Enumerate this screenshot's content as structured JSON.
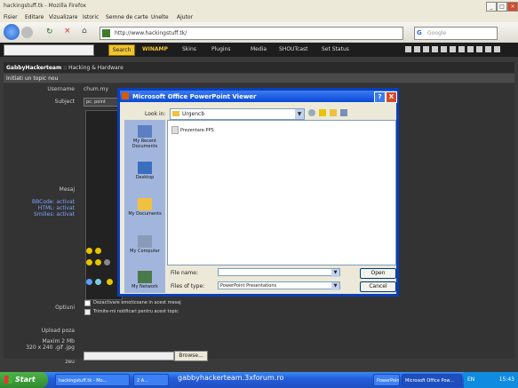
{
  "browser": {
    "title": "hackingstuff.tk - Mozilla Firefox",
    "menu": [
      "Fisier",
      "Editare",
      "Vizualizare",
      "Istoric",
      "Semne de carte",
      "Unelte",
      "Ajutor"
    ],
    "url": "http://www.hackingstuff.tk/",
    "search_placeholder": "Google",
    "toolbar_items": [
      "Search",
      "WINAMP",
      "Skins",
      "Plugins",
      "Media",
      "SHOUTcast",
      "Set Status"
    ],
    "toolbar_search_button": "Search"
  },
  "forum": {
    "site_name": "GabbyHackerteam",
    "breadcrumb": "Hacking & Hardware",
    "section_title": "Initiati un topic nou",
    "labels": {
      "username": "Username",
      "subject": "Subject",
      "message": "Mesaj",
      "bbcode": "BBCode: activat",
      "html": "HTML: activat",
      "smilies": "Smilies: activat",
      "options": "Optiuni",
      "upload": "Upload poza",
      "max_size": "Maxim 2 Mb",
      "size_hint": "320 x 240 .gif .jpg",
      "size": "zeu"
    },
    "username_value": "chum.my",
    "subject_value": "pc. point",
    "option_1": "Dezactivare emoticoane in acest mesaj",
    "option_2": "Trimite-mi notificari pentru acest topic",
    "browse_button": "Browse..."
  },
  "dialog": {
    "title": "Microsoft Office PowerPoint Viewer",
    "look_in_label": "Look in:",
    "look_in_value": "Urgencb",
    "places": [
      "My Recent Documents",
      "Desktop",
      "My Documents",
      "My Computer",
      "My Network"
    ],
    "files": [
      "Prezentare.PPS"
    ],
    "file_name_label": "File name:",
    "file_name_value": "",
    "file_type_label": "Files of type:",
    "file_type_value": "PowerPoint Presentations",
    "open_button": "Open",
    "cancel_button": "Cancel",
    "help_button": "?",
    "close_button": "X"
  },
  "taskbar": {
    "start": "Start",
    "tasks": [
      "hackingstuff.tk - Mo...",
      "2 A...",
      "",
      "",
      "",
      "",
      "PowerPoint...",
      "Microsoft Office Pow..."
    ],
    "lang": "EN",
    "clock": "15:43"
  },
  "watermark": "gabbyhackerteam.3xforum.ro",
  "colors": {
    "dialog_titlebar": "#0a49d8",
    "taskbar": "#245edb",
    "start_button": "#3c9c3a",
    "forum_bg": "#3a3a3a"
  }
}
